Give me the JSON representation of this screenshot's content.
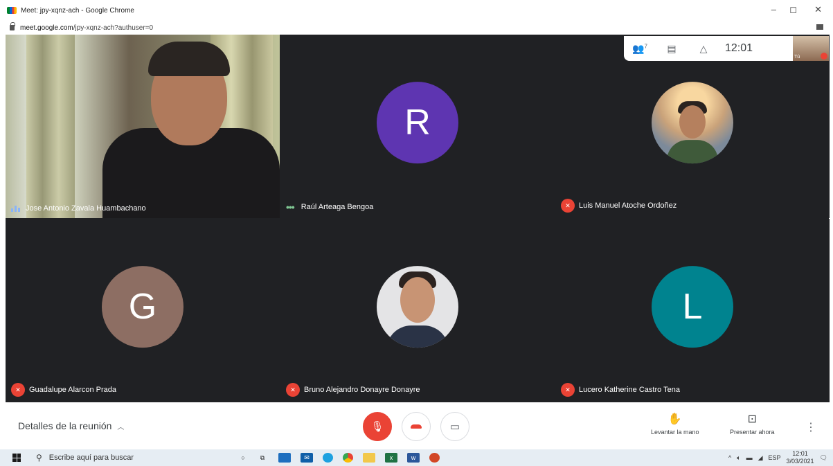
{
  "window": {
    "tab_title": "Meet: jpy-xqnz-ach - Google Chrome",
    "url_host": "meet.google.com",
    "url_path": "/jpy-xqnz-ach?authuser=0",
    "controls": {
      "minimize": "–",
      "restore": "◻",
      "close": "✕"
    }
  },
  "top_bar": {
    "icons": [
      "people-icon",
      "chat-icon",
      "activities-icon"
    ],
    "people_count": "7",
    "clock": "12:01",
    "self_label": "Tú"
  },
  "participants": [
    {
      "name": "Jose Antonio Zavala Huambachano",
      "status": "speaking",
      "type": "video"
    },
    {
      "name": "Raúl Arteaga Bengoa",
      "status": "active",
      "type": "initial",
      "initial": "R",
      "color": "#5e35b1"
    },
    {
      "name": "Luis Manuel Atoche Ordoñez",
      "status": "muted",
      "type": "photo"
    },
    {
      "name": "Guadalupe Alarcon Prada",
      "status": "muted",
      "type": "initial",
      "initial": "G",
      "color": "#8d6e63"
    },
    {
      "name": "Bruno Alejandro Donayre Donayre",
      "status": "muted",
      "type": "photo"
    },
    {
      "name": "Lucero Katherine Castro Tena",
      "status": "muted",
      "type": "initial",
      "initial": "L",
      "color": "#00838f"
    }
  ],
  "controls": {
    "details_label": "Detalles de la reunión",
    "raise_hand_label": "Levantar la mano",
    "present_label": "Presentar ahora",
    "mic_state": "off",
    "camera_state": "off"
  },
  "taskbar": {
    "search_placeholder": "Escribe aquí para buscar",
    "language": "ESP",
    "time": "12:01",
    "date": "3/03/2021",
    "apps": [
      "cortana-icon",
      "task-view-icon",
      "dell-icon",
      "mail-icon",
      "edge-icon",
      "chrome-icon",
      "explorer-icon",
      "excel-icon",
      "word-icon",
      "powerpoint-icon"
    ]
  },
  "colors": {
    "stage_bg": "#202124",
    "tile_bg": "#3c4043",
    "mute_red": "#ea4335",
    "avatar_r": "#5e35b1",
    "avatar_g": "#8d6e63",
    "avatar_l": "#00838f"
  }
}
